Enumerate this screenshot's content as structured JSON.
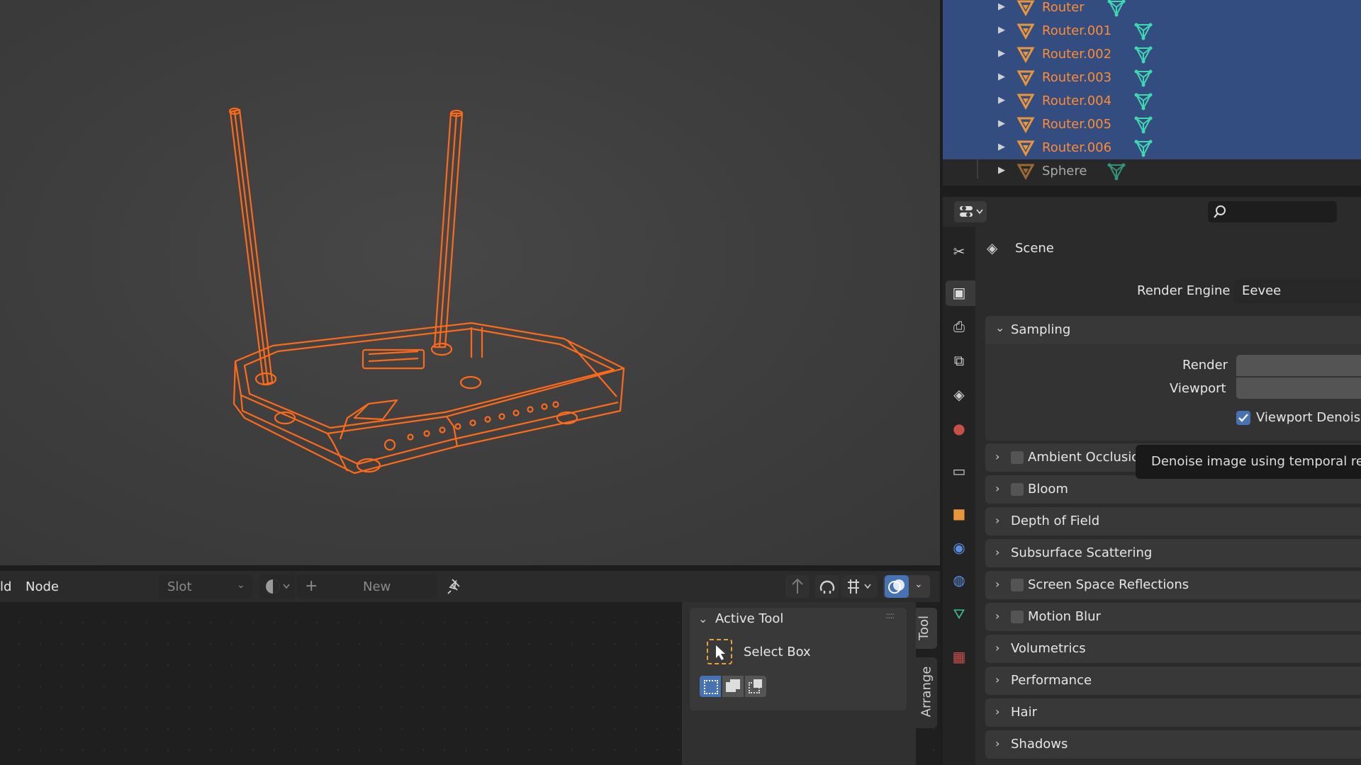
{
  "outliner": {
    "items": [
      {
        "label": "Router",
        "selected": true
      },
      {
        "label": "Router.001",
        "selected": true
      },
      {
        "label": "Router.002",
        "selected": true
      },
      {
        "label": "Router.003",
        "selected": true
      },
      {
        "label": "Router.004",
        "selected": true
      },
      {
        "label": "Router.005",
        "selected": true
      },
      {
        "label": "Router.006",
        "selected": true
      },
      {
        "label": "Sphere",
        "selected": false
      }
    ],
    "selected_color": "#ff8b33",
    "unselected_color": "#a8a8a8"
  },
  "node_editor": {
    "menu_partial": "ld",
    "menu_node": "Node",
    "slot_label": "Slot",
    "new_label": "New"
  },
  "active_tool": {
    "title": "Active Tool",
    "tool_name": "Select Box",
    "tabs": [
      "Tool",
      "Arrange"
    ]
  },
  "properties": {
    "breadcrumb": "Scene",
    "render_engine_label": "Render Engine",
    "render_engine_value": "Eevee",
    "sampling": {
      "title": "Sampling",
      "render_label": "Render",
      "viewport_label": "Viewport",
      "viewport_denoising_label": "Viewport Denoisin",
      "viewport_denoising_checked": true
    },
    "panels": [
      {
        "label": "Ambient Occlusion",
        "checkbox": true
      },
      {
        "label": "Bloom",
        "checkbox": true
      },
      {
        "label": "Depth of Field",
        "checkbox": false
      },
      {
        "label": "Subsurface Scattering",
        "checkbox": false
      },
      {
        "label": "Screen Space Reflections",
        "checkbox": true
      },
      {
        "label": "Motion Blur",
        "checkbox": true
      },
      {
        "label": "Volumetrics",
        "checkbox": false
      },
      {
        "label": "Performance",
        "checkbox": false
      },
      {
        "label": "Hair",
        "checkbox": false
      },
      {
        "label": "Shadows",
        "checkbox": false
      }
    ],
    "tooltip": "Denoise image using temporal repro"
  },
  "colors": {
    "accent_blue": "#4772b3",
    "selection_orange": "#ff6a1a",
    "outliner_selected_bg": "#334d80"
  }
}
